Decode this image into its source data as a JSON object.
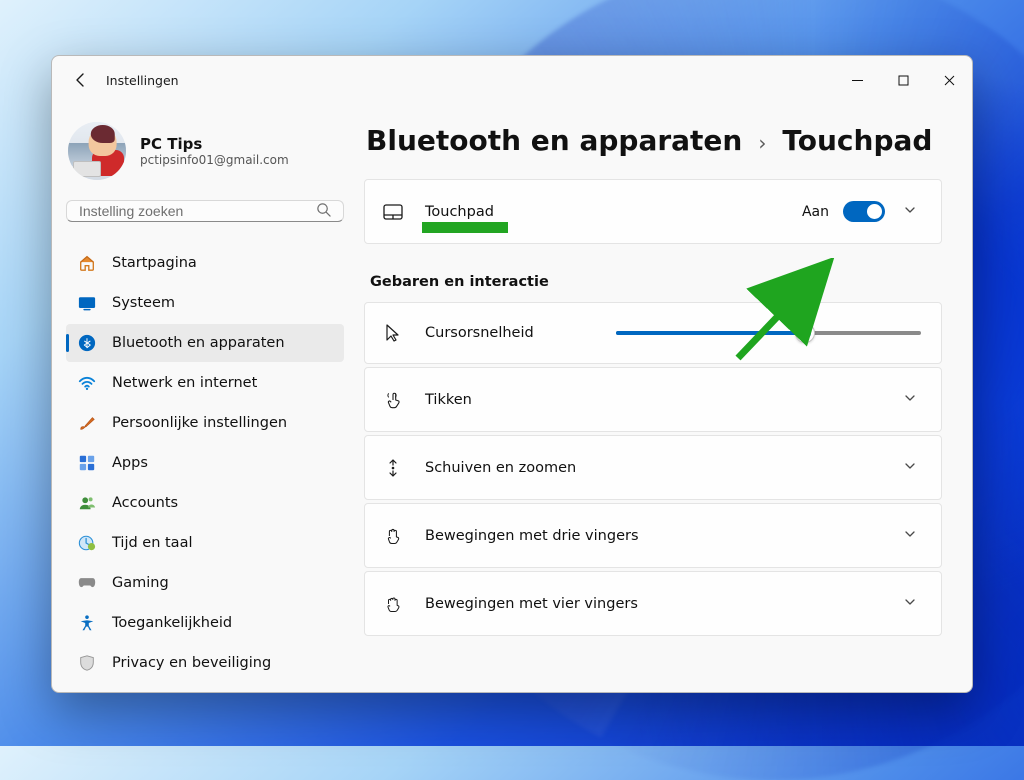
{
  "window": {
    "title": "Instellingen"
  },
  "account": {
    "name": "PC Tips",
    "email": "pctipsinfo01@gmail.com"
  },
  "search": {
    "placeholder": "Instelling zoeken"
  },
  "sidebar": {
    "items": [
      {
        "label": "Startpagina"
      },
      {
        "label": "Systeem"
      },
      {
        "label": "Bluetooth en apparaten"
      },
      {
        "label": "Netwerk en internet"
      },
      {
        "label": "Persoonlijke instellingen"
      },
      {
        "label": "Apps"
      },
      {
        "label": "Accounts"
      },
      {
        "label": "Tijd en taal"
      },
      {
        "label": "Gaming"
      },
      {
        "label": "Toegankelijkheid"
      },
      {
        "label": "Privacy en beveiliging"
      }
    ],
    "active_index": 2,
    "accent_color": "#0067c0"
  },
  "breadcrumb": {
    "parent": "Bluetooth en apparaten",
    "current": "Touchpad"
  },
  "touchpad_card": {
    "label": "Touchpad",
    "state": "Aan"
  },
  "section_heading": "Gebaren en interactie",
  "rows": {
    "cursor_speed": {
      "label": "Cursorsnelheid",
      "value_percent": 62
    },
    "tapping": {
      "label": "Tikken"
    },
    "scroll_zoom": {
      "label": "Schuiven en zoomen"
    },
    "three_finger": {
      "label": "Bewegingen met drie vingers"
    },
    "four_finger": {
      "label": "Bewegingen met vier vingers"
    }
  },
  "annotation": {
    "underline_color": "#22a522",
    "arrow_color": "#1fa51f"
  }
}
